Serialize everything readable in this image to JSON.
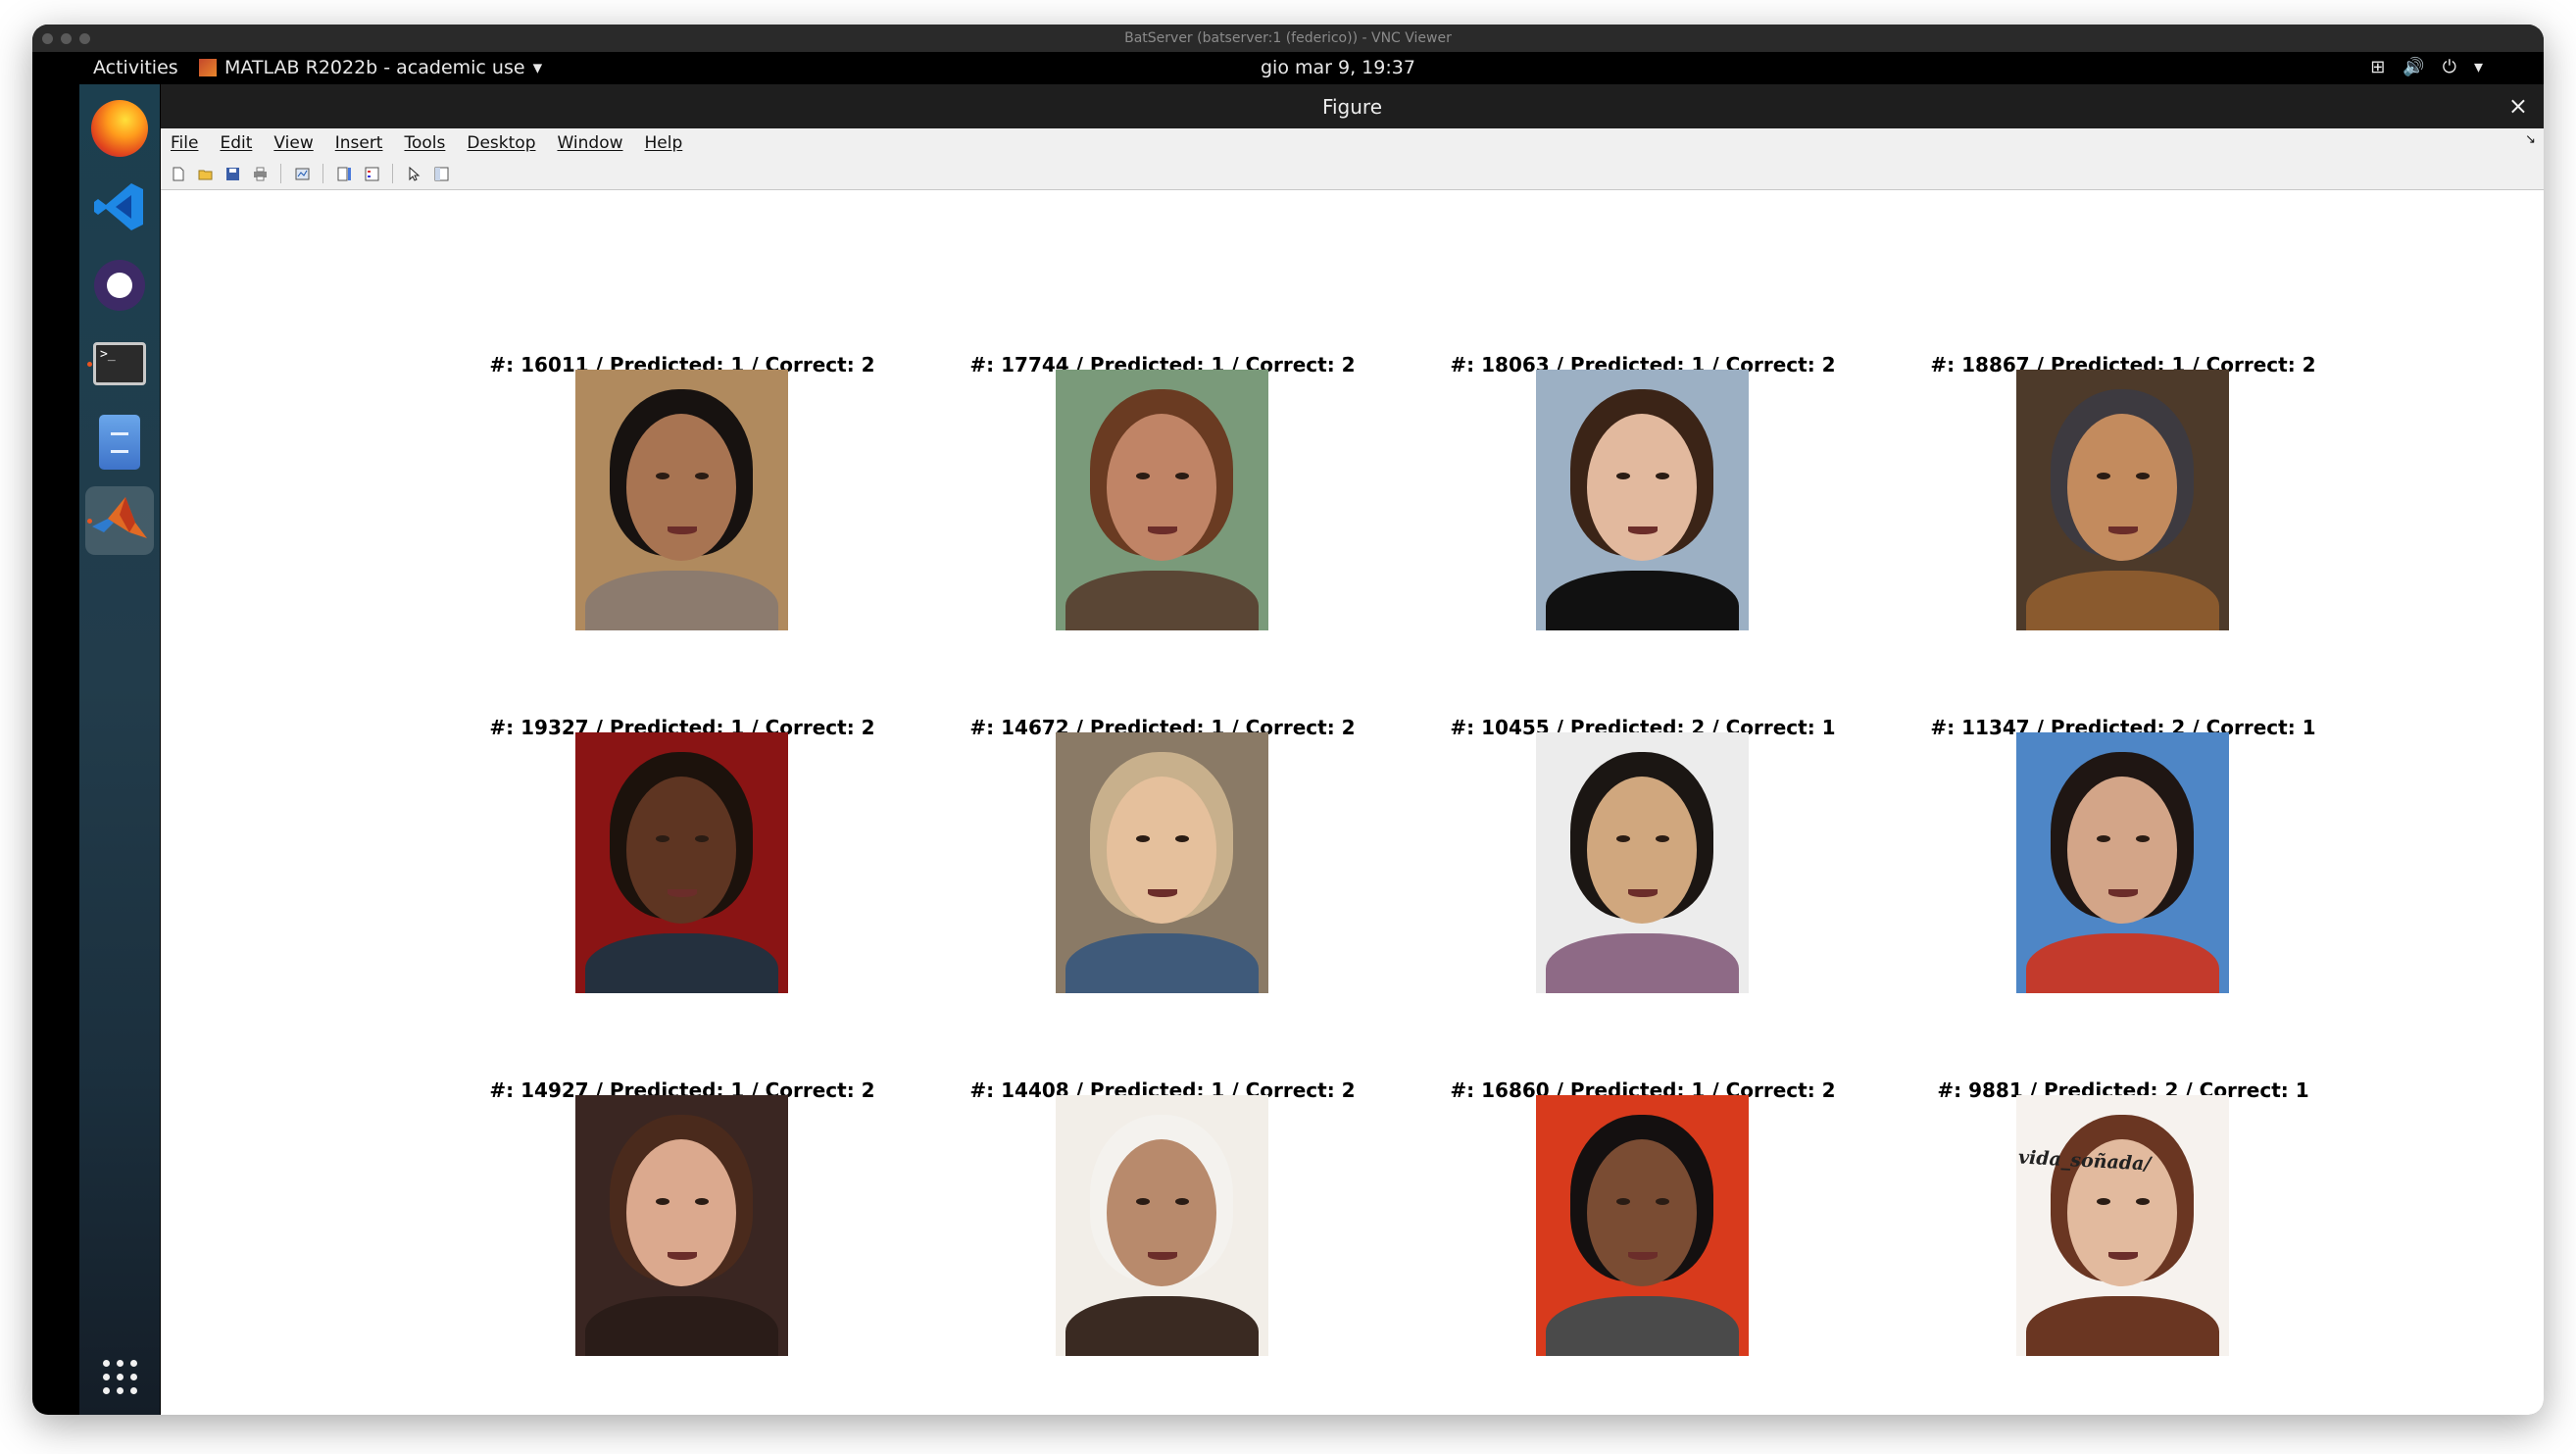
{
  "vnc": {
    "window_title": "BatServer (batserver:1 (federico)) - VNC Viewer"
  },
  "topbar": {
    "activities": "Activities",
    "app_name": "MATLAB R2022b - academic use",
    "clock": "gio mar  9, 19:37",
    "tray_icons": [
      "network-icon",
      "volume-icon",
      "power-icon",
      "chevron-down-icon"
    ]
  },
  "dock": {
    "apps": [
      "firefox",
      "visual-studio-code",
      "github-desktop",
      "terminal",
      "files",
      "matlab"
    ],
    "active_app": "matlab"
  },
  "figure": {
    "title": "Figure",
    "close": "×",
    "menu": [
      "File",
      "Edit",
      "View",
      "Insert",
      "Tools",
      "Desktop",
      "Window",
      "Help"
    ],
    "toolbar": [
      "new-figure-icon",
      "open-icon",
      "save-icon",
      "print-icon",
      "link-plot-icon",
      "colorbar-icon",
      "legend-icon",
      "pointer-icon",
      "property-editor-icon"
    ]
  },
  "grid": [
    {
      "label": "#: 16011 / Predicted: 1 / Correct: 2",
      "bg": "#b08a5e",
      "hair": "#171210",
      "skin": "#a87452",
      "body": "#8c7b6e"
    },
    {
      "label": "#: 17744 / Predicted: 1 / Correct: 2",
      "bg": "#7a9a7a",
      "hair": "#6a3b22",
      "skin": "#c08466",
      "body": "#5a4635"
    },
    {
      "label": "#: 18063 / Predicted: 1 / Correct: 2",
      "bg": "#9cb0c4",
      "hair": "#3b2417",
      "skin": "#e2b99e",
      "body": "#111111"
    },
    {
      "label": "#: 18867 / Predicted: 1 / Correct: 2",
      "bg": "#4d3a2a",
      "hair": "#3d3a40",
      "skin": "#c38b5e",
      "body": "#8a5a2e"
    },
    {
      "label": "#: 19327 / Predicted: 1 / Correct: 2",
      "bg": "#8a1414",
      "hair": "#1c120c",
      "skin": "#5e3522",
      "body": "#24303e"
    },
    {
      "label": "#: 14672 / Predicted: 1 / Correct: 2",
      "bg": "#8a7a66",
      "hair": "#c8b08c",
      "skin": "#e5c09c",
      "body": "#3f5a7a"
    },
    {
      "label": "#: 10455 / Predicted: 2 / Correct: 1",
      "bg": "#ececec",
      "hair": "#1b1613",
      "skin": "#d0a77e",
      "body": "#8e6a86"
    },
    {
      "label": "#: 11347 / Predicted: 2 / Correct: 1",
      "bg": "#4e86c6",
      "hair": "#1f1613",
      "skin": "#d3a588",
      "body": "#c33a2c"
    },
    {
      "label": "#: 14927 / Predicted: 1 / Correct: 2",
      "bg": "#3a2622",
      "hair": "#4a2a1c",
      "skin": "#dba98e",
      "body": "#2a1c18"
    },
    {
      "label": "#: 14408 / Predicted: 1 / Correct: 2",
      "bg": "#f2eee8",
      "hair": "#f4f2ee",
      "skin": "#b88a6c",
      "body": "#3a2a22"
    },
    {
      "label": "#: 16860 / Predicted: 1 / Correct: 2",
      "bg": "#d83a1c",
      "hair": "#141010",
      "skin": "#7a4c33",
      "body": "#4a4a4a"
    },
    {
      "label": "#: 9881 / Predicted: 2 / Correct: 1",
      "bg": "#f6f2ee",
      "hair": "#6a3622",
      "skin": "#e2ba9e",
      "body": "#6a3622",
      "watermark": "vida_soñada/"
    }
  ]
}
